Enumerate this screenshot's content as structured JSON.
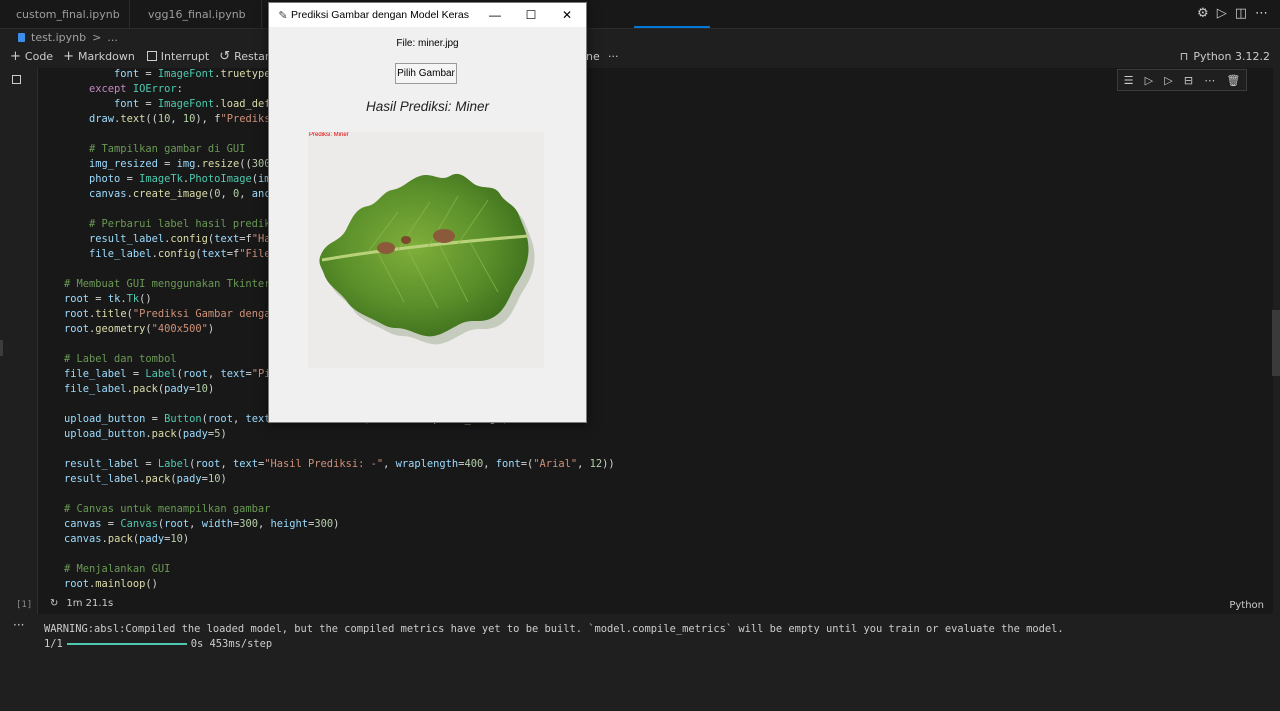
{
  "tabs": [
    {
      "label": "custom_final.ipynb"
    },
    {
      "label": "vgg16_final.ipynb"
    }
  ],
  "breadcrumb": {
    "file": "test.ipynb",
    "sep": ">",
    "more": "..."
  },
  "toolbar": {
    "code": "Code",
    "markdown": "Markdown",
    "interrupt": "Interrupt",
    "restart": "Restart",
    "outline_tail": "ne",
    "more": "···"
  },
  "kernel": {
    "label": "Python 3.12.2"
  },
  "cell": {
    "exec_count": "[1]",
    "duration": "1m 21.1s",
    "language": "Python"
  },
  "output": {
    "warning": "WARNING:absl:Compiled the loaded model, but the compiled metrics have yet to be built. `model.compile_metrics` will be empty until you train or evaluate the model.",
    "progress_label": "1/1",
    "progress_stats": "0s 453ms/step",
    "progress_fraction": 1.0
  },
  "tk_window": {
    "title": "Prediksi Gambar dengan Model Keras",
    "file_label": "File: miner.jpg",
    "button": "Pilih Gambar",
    "result": "Hasil Prediksi: Miner",
    "overlay_text": "Prediksi: Miner"
  },
  "icons": [
    "notebook-file-icon",
    "plus-icon",
    "stop-icon",
    "restart-icon",
    "settings-icon",
    "run-icon",
    "split-editor-icon",
    "flask-icon",
    "delete-icon"
  ],
  "colors": {
    "accent": "#0078d4",
    "editor_bg": "#1f1f1f",
    "progress": "#4ec9b0"
  }
}
